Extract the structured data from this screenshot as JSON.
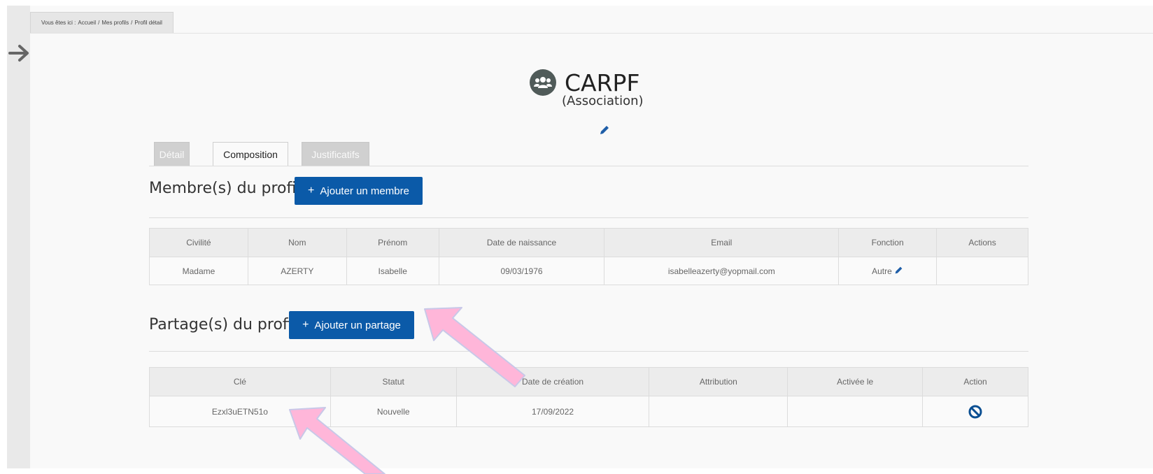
{
  "breadcrumb": {
    "prefix": "Vous êtes ici :",
    "items": [
      "Accueil",
      "/",
      "Mes profils",
      "/",
      "Profil détail"
    ]
  },
  "profile": {
    "name": "CARPF",
    "type": "(Association)"
  },
  "tabs": [
    {
      "label": "Détail",
      "active": false
    },
    {
      "label": "Composition",
      "active": true
    },
    {
      "label": "Justificatifs",
      "active": false
    }
  ],
  "members": {
    "title": "Membre(s) du profil",
    "add_button": "+ Ajouter un membre",
    "add_icon": "+",
    "add_label": "Ajouter un membre",
    "columns": [
      "Civilité",
      "Nom",
      "Prénom",
      "Date de naissance",
      "Email",
      "Fonction",
      "Actions"
    ],
    "rows": [
      {
        "civilite": "Madame",
        "nom": "AZERTY",
        "prenom": "Isabelle",
        "date_naissance": "09/03/1976",
        "email": "isabelleazerty@yopmail.com",
        "fonction": "Autre",
        "actions": ""
      }
    ]
  },
  "shares": {
    "title": "Partage(s) du profil",
    "add_icon": "+",
    "add_label": "Ajouter un partage",
    "columns": [
      "Clé",
      "Statut",
      "Date de création",
      "Attribution",
      "Activée le",
      "Action"
    ],
    "rows": [
      {
        "cle": "Ezxl3uETN51o",
        "statut": "Nouvelle",
        "date_creation": "17/09/2022",
        "attribution": "",
        "activee_le": "",
        "action_icon": "ban-icon"
      }
    ]
  },
  "colors": {
    "primary_button": "#0b5aa8",
    "annotation_arrow": "#ffb6d9",
    "icon_blue": "#0b5aa8"
  },
  "icons": {
    "rail": "arrow-right-icon",
    "org": "users-icon",
    "edit": "pencil-icon",
    "remove_share": "ban-icon"
  }
}
